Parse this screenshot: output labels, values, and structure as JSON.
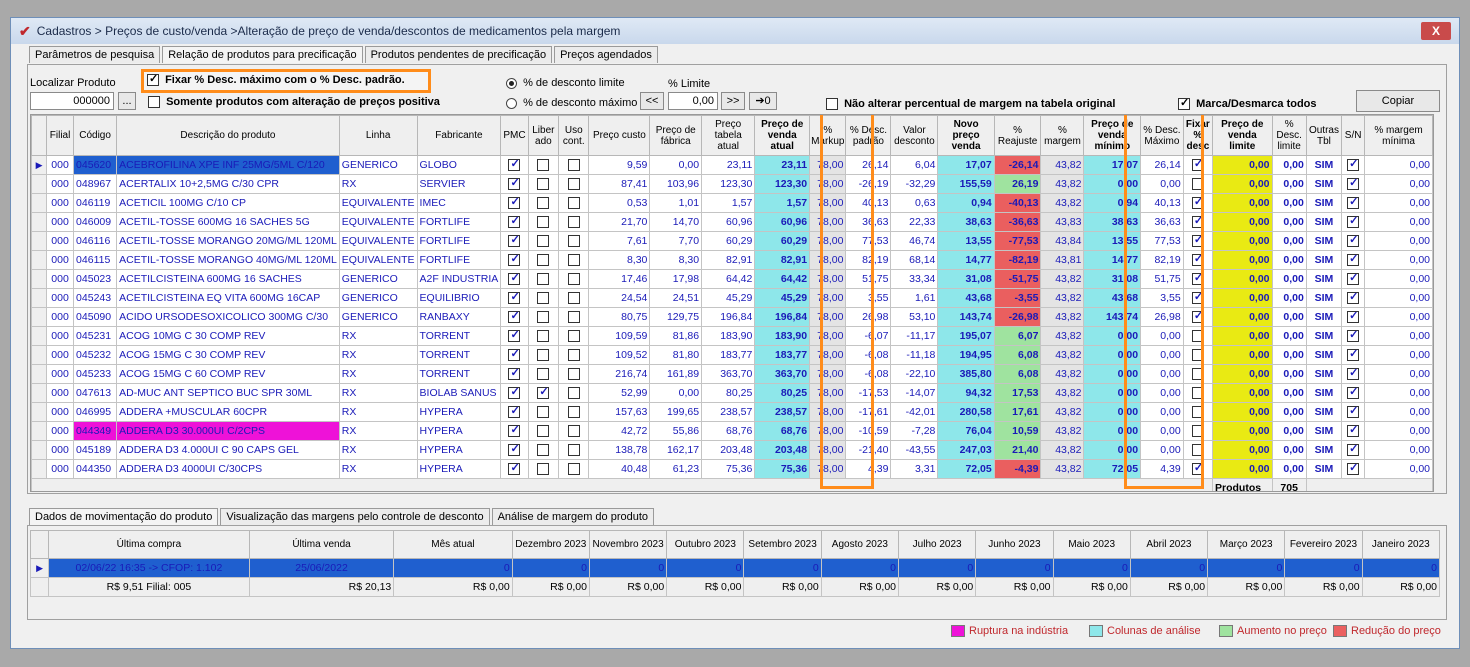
{
  "window": {
    "title": "Cadastros > Preços de custo/venda >Alteração de preço de venda/descontos de medicamentos pela margem",
    "close_label": "X"
  },
  "tabs": [
    "Parâmetros de pesquisa",
    "Relação de produtos para precificação",
    "Produtos pendentes de precificação",
    "Preços agendados"
  ],
  "filters": {
    "localizar_label": "Localizar Produto",
    "localizar_value": "000000",
    "browse_label": "...",
    "fixar_label": "Fixar % Desc. máximo com o % Desc. padrão.",
    "somente_label": "Somente produtos com alteração de preços positiva",
    "radio_limite_label": "% de desconto limite",
    "radio_maximo_label": "% de desconto máximo",
    "pct_limite_label": "% Limite",
    "pct_limite_value": "0,00",
    "nav_prev": "<<",
    "nav_next": ">>",
    "nav_apply": "➔0",
    "nao_alterar_label": "Não alterar percentual de margem na tabela original",
    "marca_label": "Marca/Desmarca todos",
    "copiar_label": "Copiar"
  },
  "columns": [
    "Filial",
    "Código",
    "Descrição do produto",
    "Linha",
    "Fabricante",
    "PMC",
    "Liber ado",
    "Uso cont.",
    "Preço custo",
    "Preço de fábrica",
    "Preço tabela atual",
    "Preço de venda atual",
    "% Markup",
    "% Desc. padrão",
    "Valor desconto",
    "Novo preço venda",
    "% Reajuste",
    "% margem",
    "Preço de venda mínimo",
    "% Desc. Máximo",
    "Fixar % desc",
    "Preço de venda limite",
    "% Desc. limite",
    "Outras Tbl",
    "S/N",
    "% margem mínima"
  ],
  "rows": [
    {
      "f": "000",
      "cod": "045620",
      "desc": "ACEBROFILINA XPE INF 25MG/5ML C/120",
      "linha": "GENERICO",
      "fab": "GLOBO",
      "pmc": true,
      "lib": false,
      "uso": false,
      "custo": "9,59",
      "fab_p": "0,00",
      "tab": "23,11",
      "venda": "23,11",
      "mk": "78,00",
      "dp": "26,14",
      "vd": "6,04",
      "novo": "17,07",
      "reaj": "-26,14",
      "marg": "43,82",
      "min": "17,07",
      "dmax": "26,14",
      "fix": true,
      "lim": "0,00",
      "dl": "0,00",
      "out": "SIM",
      "sn": true,
      "mm": "0,00"
    },
    {
      "f": "000",
      "cod": "048967",
      "desc": "ACERTALIX 10+2,5MG C/30 CPR",
      "linha": "RX",
      "fab": "SERVIER",
      "pmc": true,
      "lib": false,
      "uso": false,
      "custo": "87,41",
      "fab_p": "103,96",
      "tab": "123,30",
      "venda": "123,30",
      "mk": "78,00",
      "dp": "-26,19",
      "vd": "-32,29",
      "novo": "155,59",
      "reaj": "26,19",
      "marg": "43,82",
      "min": "0,00",
      "dmax": "0,00",
      "fix": false,
      "lim": "0,00",
      "dl": "0,00",
      "out": "SIM",
      "sn": true,
      "mm": "0,00"
    },
    {
      "f": "000",
      "cod": "046119",
      "desc": "ACETICIL 100MG C/10 CP",
      "linha": "EQUIVALENTE",
      "fab": "IMEC",
      "pmc": true,
      "lib": false,
      "uso": false,
      "custo": "0,53",
      "fab_p": "1,01",
      "tab": "1,57",
      "venda": "1,57",
      "mk": "78,00",
      "dp": "40,13",
      "vd": "0,63",
      "novo": "0,94",
      "reaj": "-40,13",
      "marg": "43,82",
      "min": "0,94",
      "dmax": "40,13",
      "fix": true,
      "lim": "0,00",
      "dl": "0,00",
      "out": "SIM",
      "sn": true,
      "mm": "0,00"
    },
    {
      "f": "000",
      "cod": "046009",
      "desc": "ACETIL-TOSSE 600MG 16 SACHES 5G",
      "linha": "EQUIVALENTE",
      "fab": "FORTLIFE",
      "pmc": true,
      "lib": false,
      "uso": false,
      "custo": "21,70",
      "fab_p": "14,70",
      "tab": "60,96",
      "venda": "60,96",
      "mk": "78,00",
      "dp": "36,63",
      "vd": "22,33",
      "novo": "38,63",
      "reaj": "-36,63",
      "marg": "43,83",
      "min": "38,63",
      "dmax": "36,63",
      "fix": true,
      "lim": "0,00",
      "dl": "0,00",
      "out": "SIM",
      "sn": true,
      "mm": "0,00"
    },
    {
      "f": "000",
      "cod": "046116",
      "desc": "ACETIL-TOSSE MORANGO 20MG/ML 120ML",
      "linha": "EQUIVALENTE",
      "fab": "FORTLIFE",
      "pmc": true,
      "lib": false,
      "uso": false,
      "custo": "7,61",
      "fab_p": "7,70",
      "tab": "60,29",
      "venda": "60,29",
      "mk": "78,00",
      "dp": "77,53",
      "vd": "46,74",
      "novo": "13,55",
      "reaj": "-77,53",
      "marg": "43,84",
      "min": "13,55",
      "dmax": "77,53",
      "fix": true,
      "lim": "0,00",
      "dl": "0,00",
      "out": "SIM",
      "sn": true,
      "mm": "0,00"
    },
    {
      "f": "000",
      "cod": "046115",
      "desc": "ACETIL-TOSSE MORANGO 40MG/ML 120ML",
      "linha": "EQUIVALENTE",
      "fab": "FORTLIFE",
      "pmc": true,
      "lib": false,
      "uso": false,
      "custo": "8,30",
      "fab_p": "8,30",
      "tab": "82,91",
      "venda": "82,91",
      "mk": "78,00",
      "dp": "82,19",
      "vd": "68,14",
      "novo": "14,77",
      "reaj": "-82,19",
      "marg": "43,81",
      "min": "14,77",
      "dmax": "82,19",
      "fix": true,
      "lim": "0,00",
      "dl": "0,00",
      "out": "SIM",
      "sn": true,
      "mm": "0,00"
    },
    {
      "f": "000",
      "cod": "045023",
      "desc": "ACETILCISTEINA 600MG 16 SACHES",
      "linha": "GENERICO",
      "fab": "A2F INDUSTRIA",
      "pmc": true,
      "lib": false,
      "uso": false,
      "custo": "17,46",
      "fab_p": "17,98",
      "tab": "64,42",
      "venda": "64,42",
      "mk": "78,00",
      "dp": "51,75",
      "vd": "33,34",
      "novo": "31,08",
      "reaj": "-51,75",
      "marg": "43,82",
      "min": "31,08",
      "dmax": "51,75",
      "fix": true,
      "lim": "0,00",
      "dl": "0,00",
      "out": "SIM",
      "sn": true,
      "mm": "0,00"
    },
    {
      "f": "000",
      "cod": "045243",
      "desc": "ACETILCISTEINA EQ VITA 600MG 16CAP",
      "linha": "GENERICO",
      "fab": "EQUILIBRIO",
      "pmc": true,
      "lib": false,
      "uso": false,
      "custo": "24,54",
      "fab_p": "24,51",
      "tab": "45,29",
      "venda": "45,29",
      "mk": "78,00",
      "dp": "3,55",
      "vd": "1,61",
      "novo": "43,68",
      "reaj": "-3,55",
      "marg": "43,82",
      "min": "43,68",
      "dmax": "3,55",
      "fix": true,
      "lim": "0,00",
      "dl": "0,00",
      "out": "SIM",
      "sn": true,
      "mm": "0,00"
    },
    {
      "f": "000",
      "cod": "045090",
      "desc": "ACIDO URSODESOXICOLICO 300MG C/30",
      "linha": "GENERICO",
      "fab": "RANBAXY",
      "pmc": true,
      "lib": false,
      "uso": false,
      "custo": "80,75",
      "fab_p": "129,75",
      "tab": "196,84",
      "venda": "196,84",
      "mk": "78,00",
      "dp": "26,98",
      "vd": "53,10",
      "novo": "143,74",
      "reaj": "-26,98",
      "marg": "43,82",
      "min": "143,74",
      "dmax": "26,98",
      "fix": true,
      "lim": "0,00",
      "dl": "0,00",
      "out": "SIM",
      "sn": true,
      "mm": "0,00"
    },
    {
      "f": "000",
      "cod": "045231",
      "desc": "ACOG 10MG C 30 COMP REV",
      "linha": "RX",
      "fab": "TORRENT",
      "pmc": true,
      "lib": false,
      "uso": false,
      "custo": "109,59",
      "fab_p": "81,86",
      "tab": "183,90",
      "venda": "183,90",
      "mk": "78,00",
      "dp": "-6,07",
      "vd": "-11,17",
      "novo": "195,07",
      "reaj": "6,07",
      "marg": "43,82",
      "min": "0,00",
      "dmax": "0,00",
      "fix": false,
      "lim": "0,00",
      "dl": "0,00",
      "out": "SIM",
      "sn": true,
      "mm": "0,00"
    },
    {
      "f": "000",
      "cod": "045232",
      "desc": "ACOG 15MG C 30 COMP REV",
      "linha": "RX",
      "fab": "TORRENT",
      "pmc": true,
      "lib": false,
      "uso": false,
      "custo": "109,52",
      "fab_p": "81,80",
      "tab": "183,77",
      "venda": "183,77",
      "mk": "78,00",
      "dp": "-6,08",
      "vd": "-11,18",
      "novo": "194,95",
      "reaj": "6,08",
      "marg": "43,82",
      "min": "0,00",
      "dmax": "0,00",
      "fix": false,
      "lim": "0,00",
      "dl": "0,00",
      "out": "SIM",
      "sn": true,
      "mm": "0,00"
    },
    {
      "f": "000",
      "cod": "045233",
      "desc": "ACOG 15MG C 60 COMP REV",
      "linha": "RX",
      "fab": "TORRENT",
      "pmc": true,
      "lib": false,
      "uso": false,
      "custo": "216,74",
      "fab_p": "161,89",
      "tab": "363,70",
      "venda": "363,70",
      "mk": "78,00",
      "dp": "-6,08",
      "vd": "-22,10",
      "novo": "385,80",
      "reaj": "6,08",
      "marg": "43,82",
      "min": "0,00",
      "dmax": "0,00",
      "fix": false,
      "lim": "0,00",
      "dl": "0,00",
      "out": "SIM",
      "sn": true,
      "mm": "0,00"
    },
    {
      "f": "000",
      "cod": "047613",
      "desc": "AD-MUC ANT SEPTICO BUC SPR 30ML",
      "linha": "RX",
      "fab": "BIOLAB SANUS",
      "pmc": true,
      "lib": true,
      "uso": false,
      "custo": "52,99",
      "fab_p": "0,00",
      "tab": "80,25",
      "venda": "80,25",
      "mk": "78,00",
      "dp": "-17,53",
      "vd": "-14,07",
      "novo": "94,32",
      "reaj": "17,53",
      "marg": "43,82",
      "min": "0,00",
      "dmax": "0,00",
      "fix": false,
      "lim": "0,00",
      "dl": "0,00",
      "out": "SIM",
      "sn": true,
      "mm": "0,00"
    },
    {
      "f": "000",
      "cod": "046995",
      "desc": "ADDERA +MUSCULAR 60CPR",
      "linha": "RX",
      "fab": "HYPERA",
      "pmc": true,
      "lib": false,
      "uso": false,
      "custo": "157,63",
      "fab_p": "199,65",
      "tab": "238,57",
      "venda": "238,57",
      "mk": "78,00",
      "dp": "-17,61",
      "vd": "-42,01",
      "novo": "280,58",
      "reaj": "17,61",
      "marg": "43,82",
      "min": "0,00",
      "dmax": "0,00",
      "fix": false,
      "lim": "0,00",
      "dl": "0,00",
      "out": "SIM",
      "sn": true,
      "mm": "0,00"
    },
    {
      "f": "000",
      "cod": "044349",
      "desc": "ADDERA D3 30.000UI C/2CPS",
      "linha": "RX",
      "fab": "HYPERA",
      "pmc": true,
      "lib": false,
      "uso": false,
      "custo": "42,72",
      "fab_p": "55,86",
      "tab": "68,76",
      "venda": "68,76",
      "mk": "78,00",
      "dp": "-10,59",
      "vd": "-7,28",
      "novo": "76,04",
      "reaj": "10,59",
      "marg": "43,82",
      "min": "0,00",
      "dmax": "0,00",
      "fix": false,
      "lim": "0,00",
      "dl": "0,00",
      "out": "SIM",
      "sn": true,
      "mm": "0,00",
      "rupture": true
    },
    {
      "f": "000",
      "cod": "045189",
      "desc": "ADDERA D3 4.000UI C 90 CAPS GEL",
      "linha": "RX",
      "fab": "HYPERA",
      "pmc": true,
      "lib": false,
      "uso": false,
      "custo": "138,78",
      "fab_p": "162,17",
      "tab": "203,48",
      "venda": "203,48",
      "mk": "78,00",
      "dp": "-21,40",
      "vd": "-43,55",
      "novo": "247,03",
      "reaj": "21,40",
      "marg": "43,82",
      "min": "0,00",
      "dmax": "0,00",
      "fix": false,
      "lim": "0,00",
      "dl": "0,00",
      "out": "SIM",
      "sn": true,
      "mm": "0,00"
    },
    {
      "f": "000",
      "cod": "044350",
      "desc": "ADDERA D3 4000UI C/30CPS",
      "linha": "RX",
      "fab": "HYPERA",
      "pmc": true,
      "lib": false,
      "uso": false,
      "custo": "40,48",
      "fab_p": "61,23",
      "tab": "75,36",
      "venda": "75,36",
      "mk": "78,00",
      "dp": "4,39",
      "vd": "3,31",
      "novo": "72,05",
      "reaj": "-4,39",
      "marg": "43,82",
      "min": "72,05",
      "dmax": "4,39",
      "fix": true,
      "lim": "0,00",
      "dl": "0,00",
      "out": "SIM",
      "sn": true,
      "mm": "0,00"
    }
  ],
  "footer": {
    "produtos_label": "Produtos",
    "produtos_count": "705"
  },
  "bottom_tabs": [
    "Dados de movimentação do produto",
    "Visualização das margens pelo controle de desconto",
    "Análise de margem do produto"
  ],
  "mov_columns": [
    "Última compra",
    "Última venda",
    "Mês atual",
    "Dezembro 2023",
    "Novembro 2023",
    "Outubro 2023",
    "Setembro 2023",
    "Agosto 2023",
    "Julho 2023",
    "Junho 2023",
    "Maio 2023",
    "Abril 2023",
    "Março 2023",
    "Fevereiro 2023",
    "Janeiro 2023"
  ],
  "mov_row1": [
    "02/06/22 16:35 -> CFOP: 1.102",
    "25/06/2022",
    "0",
    "0",
    "0",
    "0",
    "0",
    "0",
    "0",
    "0",
    "0",
    "0",
    "0",
    "0",
    "0"
  ],
  "mov_row2": [
    "R$ 9,51 Filial: 005",
    "R$ 20,13",
    "R$ 0,00",
    "R$ 0,00",
    "R$ 0,00",
    "R$ 0,00",
    "R$ 0,00",
    "R$ 0,00",
    "R$ 0,00",
    "R$ 0,00",
    "R$ 0,00",
    "R$ 0,00",
    "R$ 0,00",
    "R$ 0,00",
    "R$ 0,00"
  ],
  "legend": [
    {
      "label": "Ruptura na indústria",
      "color": "#ee12d8"
    },
    {
      "label": "Colunas de análise",
      "color": "#8ee7ea"
    },
    {
      "label": "Aumento no preço",
      "color": "#9fe39f"
    },
    {
      "label": "Redução do preço",
      "color": "#ea5f5f"
    }
  ],
  "colors": {
    "highlight": "#ff8c1a",
    "selection": "#1f5fcf"
  }
}
